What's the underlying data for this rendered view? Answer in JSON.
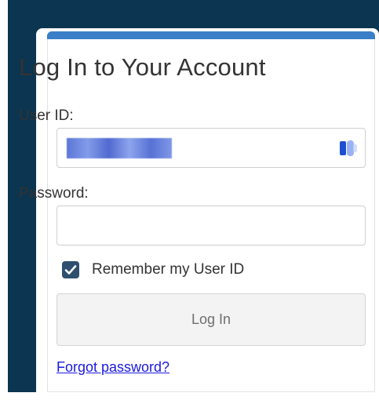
{
  "login": {
    "title": "Log In to Your Account",
    "user_id_label": "User ID:",
    "password_label": "Password:",
    "remember_label": "Remember my User ID",
    "remember_checked": true,
    "login_button": "Log In",
    "forgot_link": "Forgot password?"
  },
  "colors": {
    "navy_background": "#0b3550",
    "card_accent": "#3a7fc8",
    "checkbox": "#2f4f6f",
    "link": "#1a1adf"
  },
  "icons": {
    "password_manager": "password-manager-icon",
    "checkmark": "checkmark-icon"
  }
}
